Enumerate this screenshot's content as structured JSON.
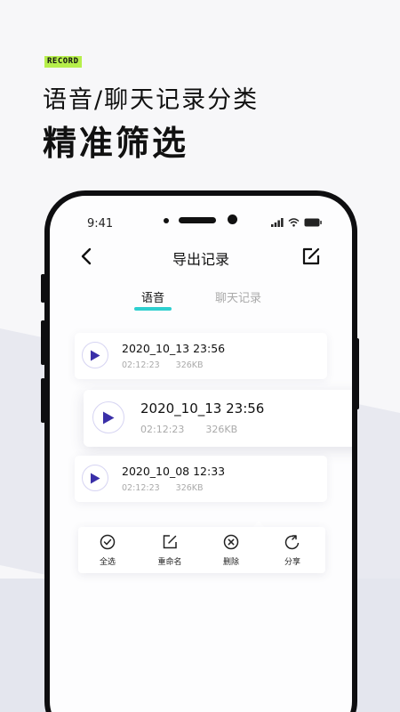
{
  "hero": {
    "tag": "RECORD",
    "subtitle": "语音/聊天记录分类",
    "headline": "精准筛选"
  },
  "status_bar": {
    "time": "9:41"
  },
  "nav": {
    "title": "导出记录",
    "back_icon": "chevron-left-icon",
    "edit_icon": "edit-icon"
  },
  "tabs": [
    {
      "label": "语音",
      "active": true
    },
    {
      "label": "聊天记录",
      "active": false
    }
  ],
  "records": [
    {
      "name": "2020_10_13 23:56",
      "duration": "02:12:23",
      "size": "326KB",
      "selected": false
    },
    {
      "name": "2020_10_13 23:56",
      "duration": "02:12:23",
      "size": "326KB",
      "selected": true
    },
    {
      "name": "2020_10_08 12:33",
      "duration": "02:12:23",
      "size": "326KB",
      "selected": false
    }
  ],
  "toolbar": [
    {
      "label": "全选",
      "icon": "check-circle-icon"
    },
    {
      "label": "重命名",
      "icon": "rename-icon"
    },
    {
      "label": "删除",
      "icon": "delete-icon"
    },
    {
      "label": "分享",
      "icon": "share-icon"
    }
  ],
  "colors": {
    "accent": "#3a2fa8",
    "tab_underline": "#2ecfcf",
    "tag_bg": "#b6ef4b"
  }
}
